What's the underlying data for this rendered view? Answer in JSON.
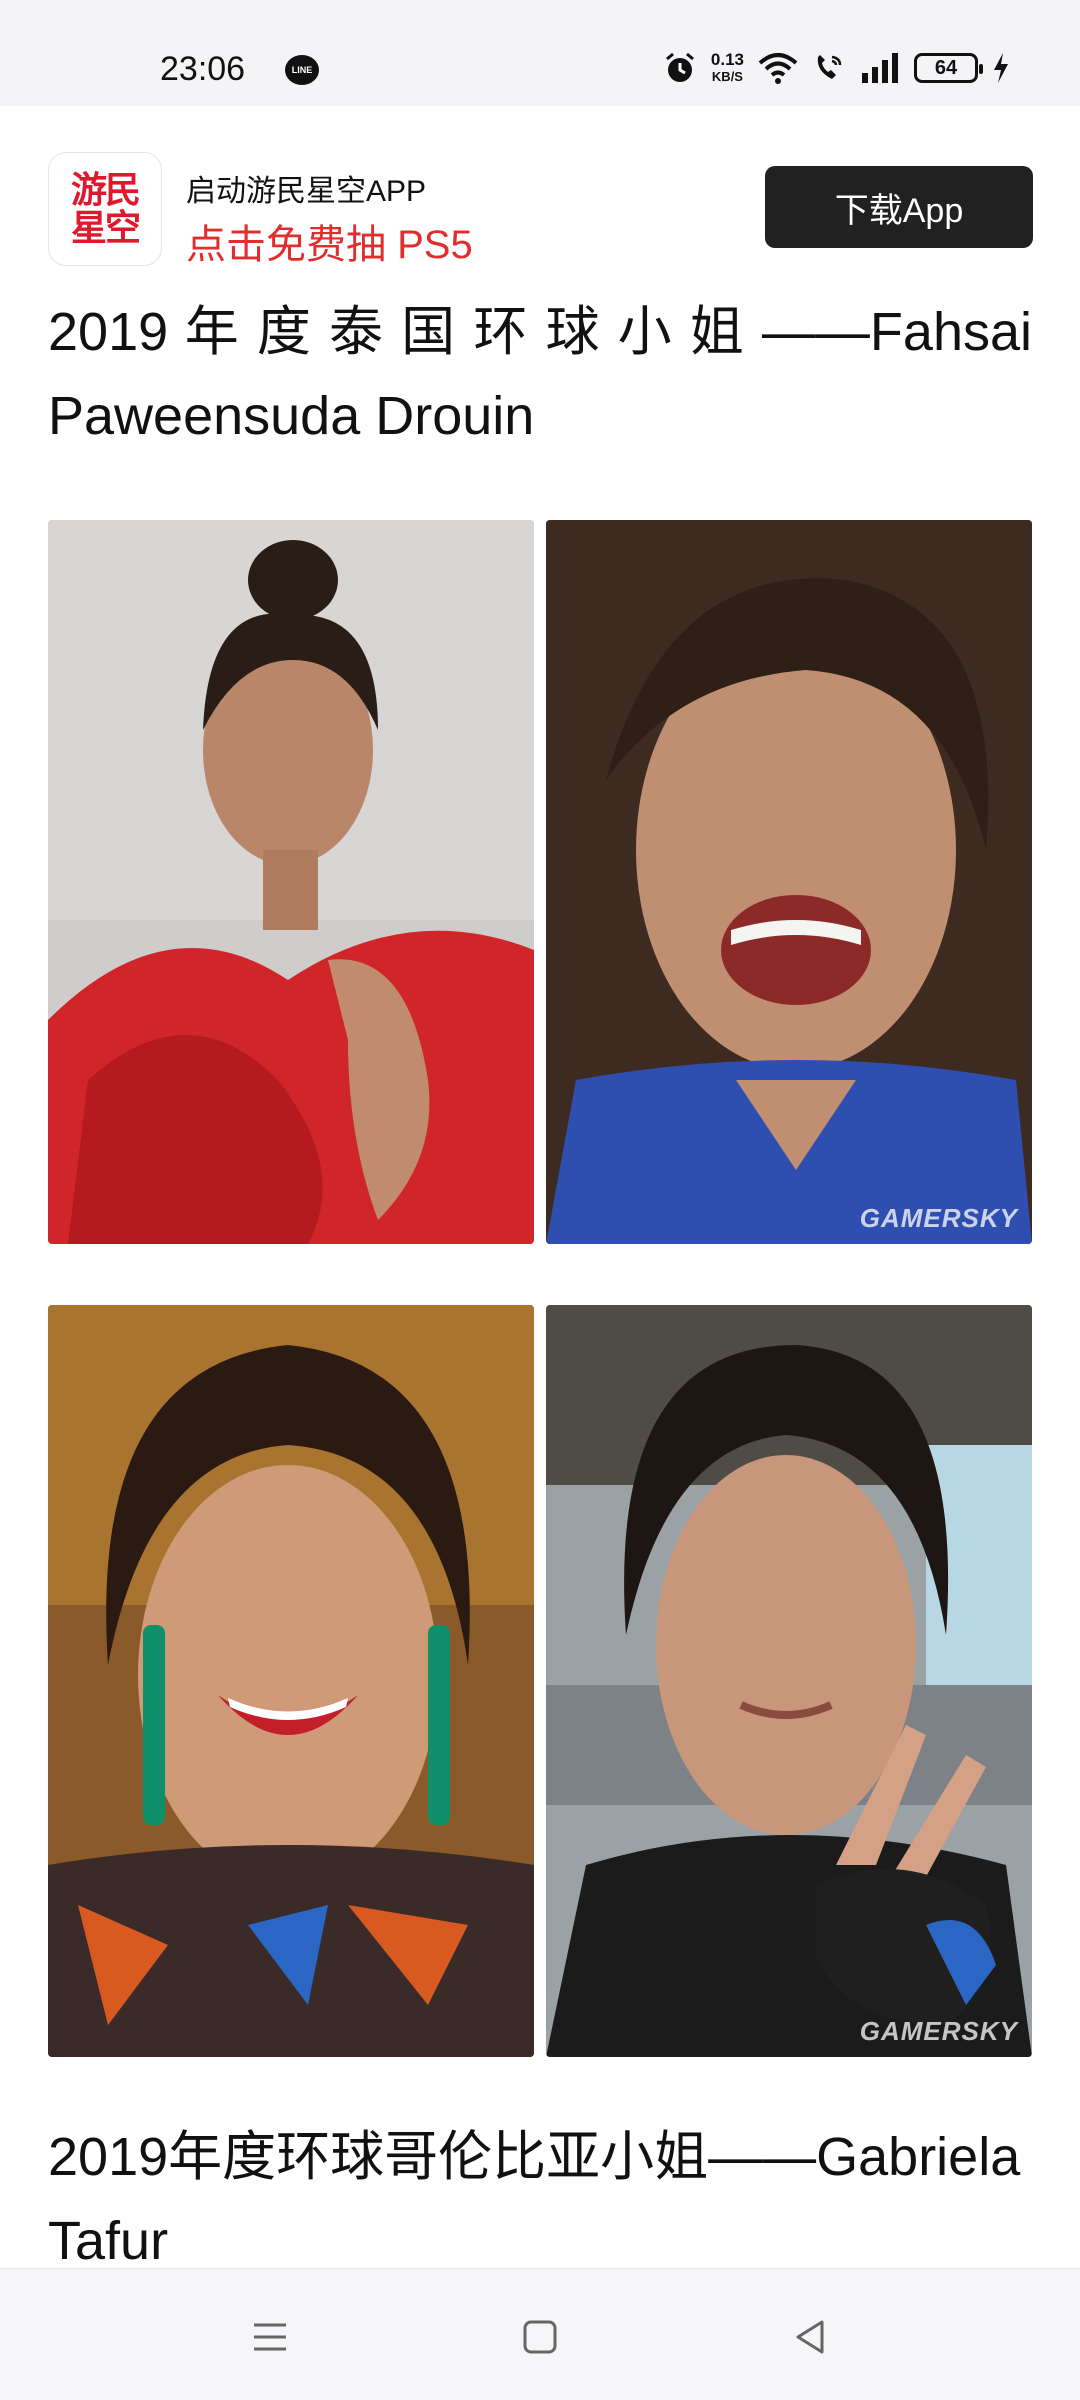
{
  "status_bar": {
    "time": "23:06",
    "line_icon_text": "LINE",
    "speed_value": "0.13",
    "speed_unit": "KB/S",
    "battery": "64"
  },
  "ad": {
    "logo_line1": "游民",
    "logo_line2": "星空",
    "title": "启动游民星空APP",
    "subtitle": "点击免费抽 PS5",
    "button": "下载App",
    "brand_color": "#e0182d"
  },
  "article": {
    "title_1": "2019 年 度 泰 国 环 球 小 姐 ——Fahsai Paweensuda Drouin",
    "title_2": "2019年度环球哥伦比亚小姐——Gabriela Tafur",
    "watermark": "GAMERSKY",
    "photos": [
      "red-dress-portrait",
      "blue-shirt-smiling-selfie",
      "green-earrings-portrait",
      "gym-peace-sign-selfie"
    ]
  },
  "nav_bar": {
    "icons": [
      "menu-icon",
      "home-square-icon",
      "back-triangle-icon"
    ]
  }
}
